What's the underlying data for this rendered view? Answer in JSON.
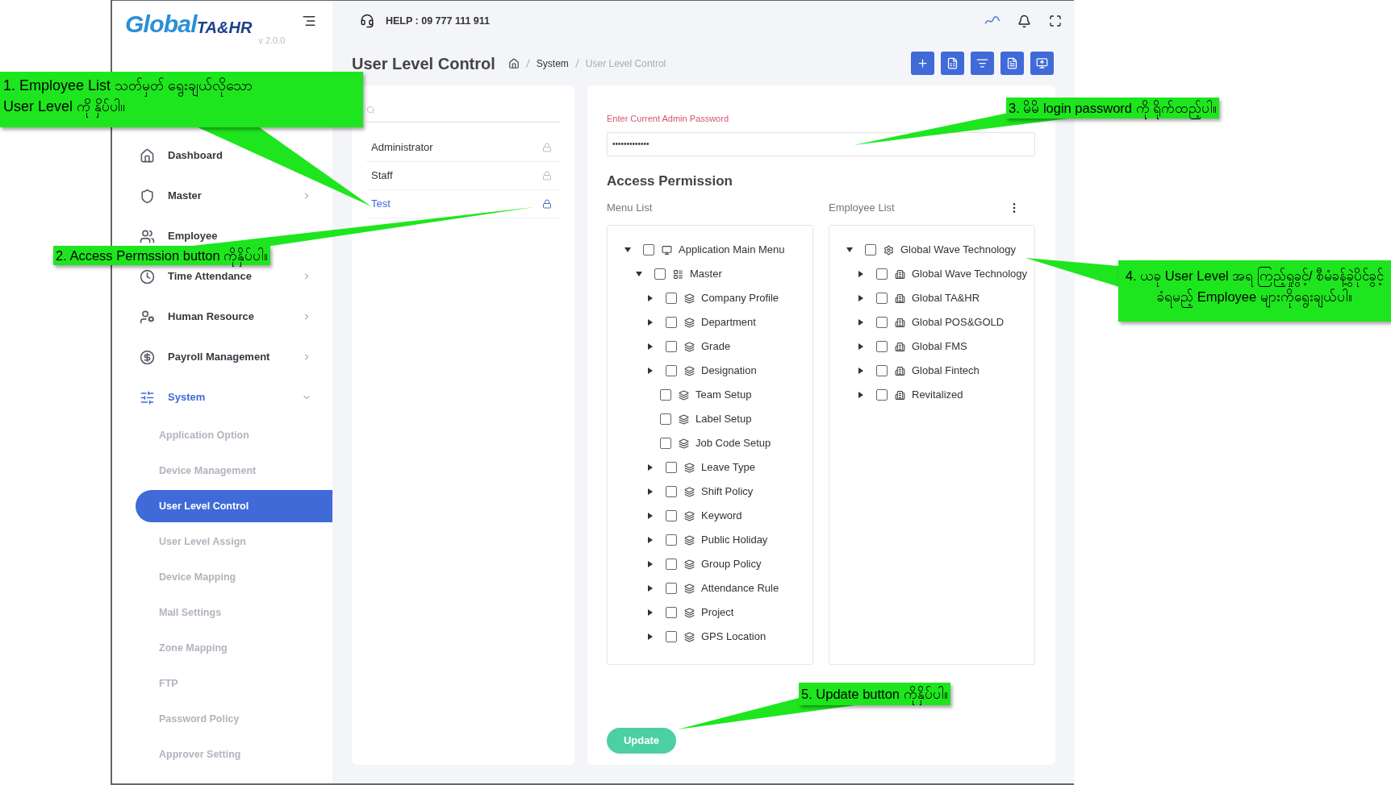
{
  "sidebar": {
    "logo": {
      "word": "Global",
      "suffix": "TA&HR"
    },
    "version": "v 2.0.0",
    "items": [
      {
        "label": "Dashboard",
        "selected": false
      },
      {
        "label": "Master",
        "selected": false,
        "expanded": false
      },
      {
        "label": "Employee",
        "selected": false
      },
      {
        "label": "Time Attendance",
        "selected": false,
        "expanded": false
      },
      {
        "label": "Human Resource",
        "selected": false,
        "expanded": false
      },
      {
        "label": "Payroll Management",
        "selected": false,
        "expanded": false
      },
      {
        "label": "System",
        "selected": true,
        "expanded": true,
        "children": [
          {
            "label": "Application Option",
            "selected": false
          },
          {
            "label": "Device Management",
            "selected": false
          },
          {
            "label": "User Level Control",
            "selected": true
          },
          {
            "label": "User Level Assign",
            "selected": false
          },
          {
            "label": "Device Mapping",
            "selected": false
          },
          {
            "label": "Mail Settings",
            "selected": false
          },
          {
            "label": "Zone Mapping",
            "selected": false
          },
          {
            "label": "FTP",
            "selected": false
          },
          {
            "label": "Password Policy",
            "selected": false
          },
          {
            "label": "Approver Setting",
            "selected": false
          }
        ]
      }
    ]
  },
  "header": {
    "help": "HELP : 09 777 111 911"
  },
  "page": {
    "title": "User Level Control",
    "breadcrumb": [
      "System",
      "User Level Control"
    ]
  },
  "user_levels": [
    {
      "label": "Administrator",
      "selected": false
    },
    {
      "label": "Staff",
      "selected": false
    },
    {
      "label": "Test",
      "selected": true
    }
  ],
  "password": {
    "label": "Enter Current Admin Password",
    "value": "•••••••••••••"
  },
  "access": {
    "title": "Access Permission",
    "menu_list": {
      "label": "Menu List",
      "tree": [
        {
          "label": "Application Main Menu",
          "checked": false,
          "expanded": true,
          "children": [
            {
              "label": "Master",
              "checked": false,
              "expanded": true,
              "children": [
                {
                  "label": "Company Profile",
                  "checked": false,
                  "expanded": false
                },
                {
                  "label": "Department",
                  "checked": false,
                  "expanded": false
                },
                {
                  "label": "Grade",
                  "checked": false,
                  "expanded": false
                },
                {
                  "label": "Designation",
                  "checked": false,
                  "expanded": false
                },
                {
                  "label": "Team Setup",
                  "checked": false
                },
                {
                  "label": "Label Setup",
                  "checked": false
                },
                {
                  "label": "Job Code Setup",
                  "checked": false
                },
                {
                  "label": "Leave Type",
                  "checked": false,
                  "expanded": false
                },
                {
                  "label": "Shift Policy",
                  "checked": false,
                  "expanded": false
                },
                {
                  "label": "Keyword",
                  "checked": false,
                  "expanded": false
                },
                {
                  "label": "Public Holiday",
                  "checked": false,
                  "expanded": false
                },
                {
                  "label": "Group Policy",
                  "checked": false,
                  "expanded": false
                },
                {
                  "label": "Attendance Rule",
                  "checked": false,
                  "expanded": false
                },
                {
                  "label": "Project",
                  "checked": false,
                  "expanded": false
                },
                {
                  "label": "GPS Location",
                  "checked": false,
                  "expanded": false
                }
              ]
            }
          ]
        }
      ]
    },
    "employee_list": {
      "label": "Employee List",
      "tree": [
        {
          "label": "Global Wave Technology",
          "checked": false,
          "expanded": true,
          "children": [
            {
              "label": "Global Wave Technology",
              "checked": false,
              "expanded": false
            },
            {
              "label": "Global TA&HR",
              "checked": false,
              "expanded": false
            },
            {
              "label": "Global POS&GOLD",
              "checked": false,
              "expanded": false
            },
            {
              "label": "Global FMS",
              "checked": false,
              "expanded": false
            },
            {
              "label": "Global Fintech",
              "checked": false,
              "expanded": false
            },
            {
              "label": "Revitalized",
              "checked": false,
              "expanded": false
            }
          ]
        }
      ]
    }
  },
  "update_button": "Update",
  "callouts": [
    {
      "text": "1. Employee List သတ်မှတ် ရွေးချယ်လိုသော User Level ကို နှိပ်ပါ။"
    },
    {
      "text": "2. Access Permssion button ကိုနှိပ်ပါ။"
    },
    {
      "text": "3. မိမိ login password ကို ရိုက်ထည့်ပါ။"
    },
    {
      "text": "4. ယခု User Level အရ ကြည့်ရှုခွင့်/ စီမံခန့်ခွဲပိုင်ခွင့် ခံရမည့် Employee များကိုရွေးချယ်ပါ။"
    },
    {
      "text": "5. Update button ကိုနှိပ်ပါ။"
    }
  ]
}
